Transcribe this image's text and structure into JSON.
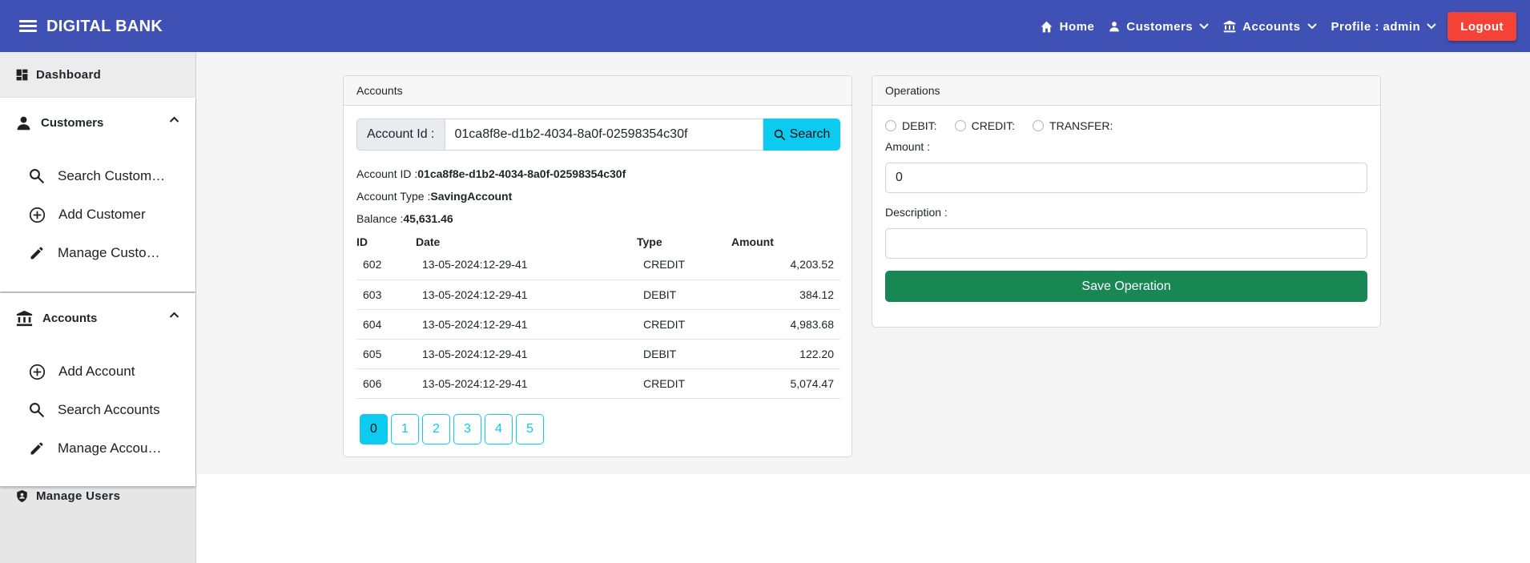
{
  "app": {
    "title": "DIGITAL BANK"
  },
  "nav": {
    "home": "Home",
    "customers": "Customers",
    "accounts": "Accounts",
    "profile": "Profile : admin",
    "logout": "Logout"
  },
  "sidebar": {
    "dashboard": "Dashboard",
    "customers": {
      "title": "Customers",
      "items": [
        {
          "label": "Search Custom…",
          "icon": "search-icon"
        },
        {
          "label": "Add Customer",
          "icon": "add-circle-icon"
        },
        {
          "label": "Manage Custo…",
          "icon": "edit-icon"
        }
      ]
    },
    "accounts": {
      "title": "Accounts",
      "items": [
        {
          "label": "Add Account",
          "icon": "add-circle-icon"
        },
        {
          "label": "Search Accounts",
          "icon": "search-icon"
        },
        {
          "label": "Manage Accou…",
          "icon": "edit-icon"
        }
      ]
    },
    "manage_users": "Manage Users"
  },
  "accounts_card": {
    "header": "Accounts",
    "search": {
      "label": "Account Id :",
      "value": "01ca8f8e-d1b2-4034-8a0f-02598354c30f",
      "button": "Search"
    },
    "account_id_label": "Account ID :",
    "account_id": "01ca8f8e-d1b2-4034-8a0f-02598354c30f",
    "account_type_label": "Account Type :",
    "account_type": "SavingAccount",
    "balance_label": "Balance :",
    "balance": "45,631.46",
    "table": {
      "headers": [
        "ID",
        "Date",
        "Type",
        "Amount"
      ],
      "rows": [
        {
          "id": "602",
          "date": "13-05-2024:12-29-41",
          "type": "CREDIT",
          "amount": "4,203.52"
        },
        {
          "id": "603",
          "date": "13-05-2024:12-29-41",
          "type": "DEBIT",
          "amount": "384.12"
        },
        {
          "id": "604",
          "date": "13-05-2024:12-29-41",
          "type": "CREDIT",
          "amount": "4,983.68"
        },
        {
          "id": "605",
          "date": "13-05-2024:12-29-41",
          "type": "DEBIT",
          "amount": "122.20"
        },
        {
          "id": "606",
          "date": "13-05-2024:12-29-41",
          "type": "CREDIT",
          "amount": "5,074.47"
        }
      ]
    },
    "pages": [
      "0",
      "1",
      "2",
      "3",
      "4",
      "5"
    ],
    "active_page": "0"
  },
  "operations_card": {
    "header": "Operations",
    "radios": [
      "DEBIT:",
      "CREDIT:",
      "TRANSFER:"
    ],
    "amount_label": "Amount :",
    "amount_value": "0",
    "description_label": "Description :",
    "description_value": "",
    "save_button": "Save Operation"
  },
  "colors": {
    "topbar": "#3f51b5",
    "logout": "#f44336",
    "info": "#0dcaf0",
    "success": "#198754"
  }
}
